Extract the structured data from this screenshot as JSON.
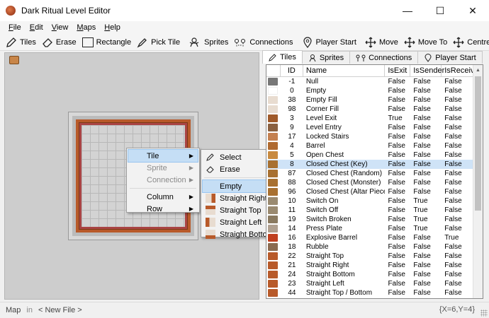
{
  "window": {
    "title": "Dark Ritual Level Editor",
    "minimize": "—",
    "maximize": "☐",
    "close": "✕"
  },
  "menu": [
    {
      "ul": "F",
      "rest": "ile"
    },
    {
      "ul": "E",
      "rest": "dit"
    },
    {
      "ul": "V",
      "rest": "iew"
    },
    {
      "ul": "M",
      "rest": "aps"
    },
    {
      "ul": "H",
      "rest": "elp"
    }
  ],
  "toolbar": {
    "tiles": "Tiles",
    "erase": "Erase",
    "rectangle": "Rectangle",
    "pick_tile": "Pick Tile",
    "sprites": "Sprites",
    "connections": "Connections",
    "player_start": "Player Start",
    "move": "Move",
    "move_to": "Move To",
    "centre": "Centre"
  },
  "context_menu": {
    "tile": "Tile",
    "sprite": "Sprite",
    "connection": "Connection",
    "column": "Column",
    "row": "Row"
  },
  "submenu": {
    "select": "Select",
    "erase": "Erase",
    "empty": "Empty",
    "straight_right": "Straight Right",
    "straight_top": "Straight Top",
    "straight_left": "Straight Left",
    "straight_bottom": "Straight Bottom"
  },
  "tabs": {
    "tiles": "Tiles",
    "sprites": "Sprites",
    "connections": "Connections",
    "player_start": "Player Start"
  },
  "table": {
    "headers": {
      "id": "ID",
      "name": "Name",
      "is_exit": "IsExit",
      "is_sender": "IsSender",
      "is_receiver": "IsReceiver"
    },
    "rows": [
      {
        "id": "-1",
        "name": "Null",
        "exit": "False",
        "send": "False",
        "recv": "False",
        "color": "#777777"
      },
      {
        "id": "0",
        "name": "Empty",
        "exit": "False",
        "send": "False",
        "recv": "False",
        "color": "#ffffff"
      },
      {
        "id": "38",
        "name": "Empty Fill",
        "exit": "False",
        "send": "False",
        "recv": "False",
        "color": "#e8dcd0"
      },
      {
        "id": "98",
        "name": "Corner Fill",
        "exit": "False",
        "send": "False",
        "recv": "False",
        "color": "#e8dcd0"
      },
      {
        "id": "3",
        "name": "Level Exit",
        "exit": "True",
        "send": "False",
        "recv": "False",
        "color": "#a05a2a"
      },
      {
        "id": "9",
        "name": "Level Entry",
        "exit": "False",
        "send": "False",
        "recv": "False",
        "color": "#8a6040"
      },
      {
        "id": "17",
        "name": "Locked Stairs",
        "exit": "False",
        "send": "False",
        "recv": "False",
        "color": "#c48050"
      },
      {
        "id": "4",
        "name": "Barrel",
        "exit": "False",
        "send": "False",
        "recv": "False",
        "color": "#b06a30"
      },
      {
        "id": "5",
        "name": "Open Chest",
        "exit": "False",
        "send": "False",
        "recv": "False",
        "color": "#c88a40"
      },
      {
        "id": "8",
        "name": "Closed Chest (Key)",
        "exit": "False",
        "send": "False",
        "recv": "False",
        "color": "#a87030"
      },
      {
        "id": "87",
        "name": "Closed Chest (Random)",
        "exit": "False",
        "send": "False",
        "recv": "False",
        "color": "#a87030"
      },
      {
        "id": "88",
        "name": "Closed Chest (Monster)",
        "exit": "False",
        "send": "False",
        "recv": "False",
        "color": "#a87030"
      },
      {
        "id": "96",
        "name": "Closed Chest (Altar Piece)",
        "exit": "False",
        "send": "False",
        "recv": "False",
        "color": "#a87030"
      },
      {
        "id": "10",
        "name": "Switch On",
        "exit": "False",
        "send": "True",
        "recv": "False",
        "color": "#9a8a70"
      },
      {
        "id": "11",
        "name": "Switch Off",
        "exit": "False",
        "send": "True",
        "recv": "False",
        "color": "#9a8a70"
      },
      {
        "id": "19",
        "name": "Switch Broken",
        "exit": "False",
        "send": "True",
        "recv": "False",
        "color": "#8a7a60"
      },
      {
        "id": "14",
        "name": "Press Plate",
        "exit": "False",
        "send": "True",
        "recv": "False",
        "color": "#b0a090"
      },
      {
        "id": "16",
        "name": "Explosive Barrel",
        "exit": "False",
        "send": "False",
        "recv": "True",
        "color": "#c04020"
      },
      {
        "id": "18",
        "name": "Rubble",
        "exit": "False",
        "send": "False",
        "recv": "False",
        "color": "#8a6a50"
      },
      {
        "id": "22",
        "name": "Straight Top",
        "exit": "False",
        "send": "False",
        "recv": "False",
        "color": "#b85a2a"
      },
      {
        "id": "21",
        "name": "Straight Right",
        "exit": "False",
        "send": "False",
        "recv": "False",
        "color": "#b85a2a"
      },
      {
        "id": "24",
        "name": "Straight Bottom",
        "exit": "False",
        "send": "False",
        "recv": "False",
        "color": "#b85a2a"
      },
      {
        "id": "23",
        "name": "Straight Left",
        "exit": "False",
        "send": "False",
        "recv": "False",
        "color": "#b85a2a"
      },
      {
        "id": "44",
        "name": "Straight Top / Bottom",
        "exit": "False",
        "send": "False",
        "recv": "False",
        "color": "#b85a2a"
      }
    ]
  },
  "status": {
    "map_label": "Map",
    "in_label": "in",
    "file": "< New File >",
    "coords": "{X=6,Y=4}"
  }
}
